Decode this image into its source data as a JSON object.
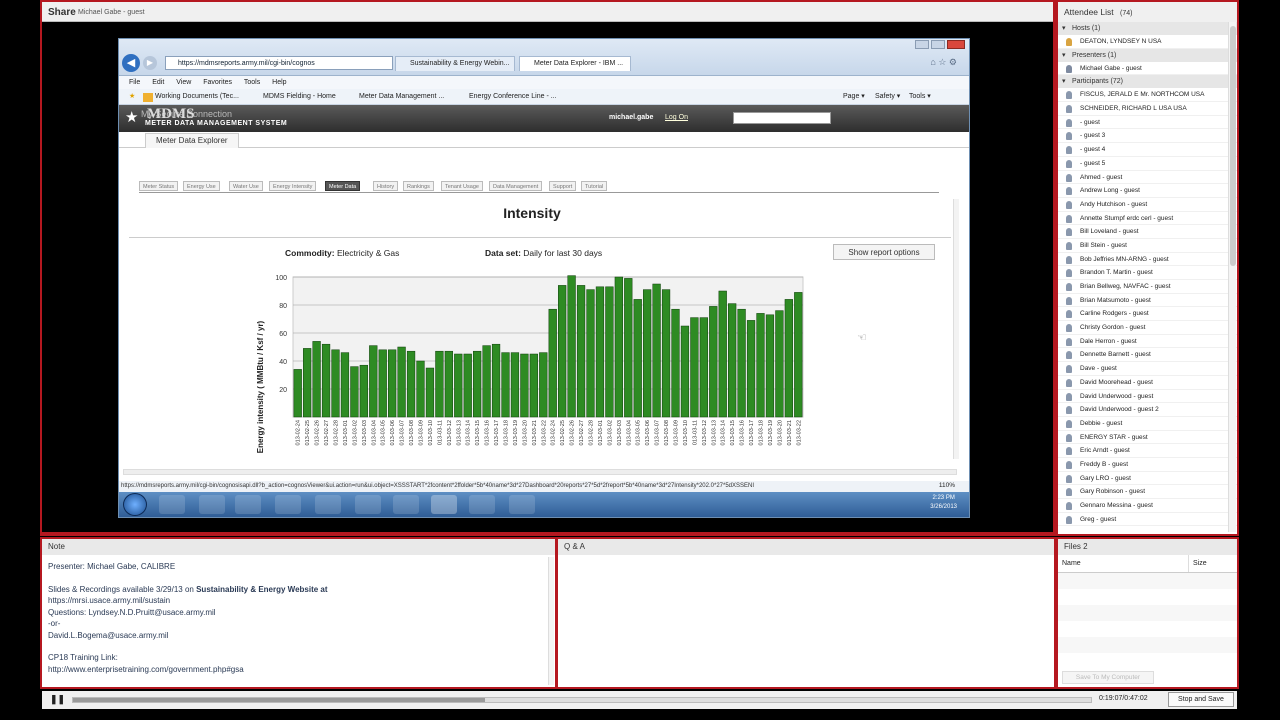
{
  "share": {
    "title": "Share",
    "presenter": "Michael Gabe - guest"
  },
  "browser": {
    "url": "https://mdmsreports.army.mil/cgi-bin/cognos",
    "tabs": [
      "Sustainability & Energy Webin...",
      "Meter Data Explorer - IBM ..."
    ],
    "menu": [
      "File",
      "Edit",
      "View",
      "Favorites",
      "Tools",
      "Help"
    ],
    "favorites": [
      "Working Documents (Tec...",
      "MDMS Fielding - Home",
      "Meter Data Management ...",
      "Energy Conference Line - ..."
    ],
    "cmdbar": [
      "Page ▾",
      "Safety ▾",
      "Tools ▾"
    ],
    "status_url": "https://mdmsreports.army.mil/cgi-bin/cognosisapi.dll?b_action=cognosViewer&ui.action=run&ui.object=XSSSTART*2fcontent*2ffolder*5b*40name*3d*27Dashboard*20reports*27*5d*2freport*5b*40name*3d*27Intensity*202.0*27*5dXSSENI",
    "zoom": "110%",
    "clock_time": "2:23 PM",
    "clock_date": "3/26/2013"
  },
  "mdms": {
    "logo": "MDMS",
    "subtitle": "METER DATA MANAGEMENT SYSTEM",
    "overlay": "My Secure Connection",
    "user": "michael.gabe",
    "logon": "Log On",
    "app_tab": "Meter Data Explorer",
    "subtabs": [
      "Meter Status",
      "Energy Use",
      "Water Use",
      "Energy Intensity",
      "Meter Data",
      "History",
      "Rankings",
      "Tenant Usage",
      "Data Management",
      "Support",
      "Tutorial"
    ],
    "active_subtab": "Meter Data",
    "report_title": "Intensity",
    "commodity_label": "Commodity:",
    "commodity_value": "Electricity & Gas",
    "dataset_label": "Data set:",
    "dataset_value": "Daily for last 30 days",
    "options_button": "Show report options"
  },
  "chart_data": {
    "type": "bar",
    "ylabel": "Energy intensity ( MMBtu / Ksf / yr)",
    "ylim": [
      0,
      100
    ],
    "yticks": [
      "100",
      "80",
      "60",
      "40",
      "20"
    ],
    "color": "#2e8b23",
    "categories": [
      "013-02-24",
      "013-02-25",
      "013-02-26",
      "013-02-27",
      "013-02-28",
      "013-03-01",
      "013-03-02",
      "013-03-03",
      "013-03-04",
      "013-03-05",
      "013-03-06",
      "013-03-07",
      "013-03-08",
      "013-03-09",
      "013-03-10",
      "013-03-11",
      "013-03-12",
      "013-03-13",
      "013-03-14",
      "013-03-15",
      "013-03-16",
      "013-03-17",
      "013-03-18",
      "013-03-19",
      "013-03-20",
      "013-03-21",
      "013-03-22",
      "013-02-24",
      "013-02-25",
      "013-02-26",
      "013-02-27",
      "013-02-28",
      "013-03-01",
      "013-03-02",
      "013-03-03",
      "013-03-04",
      "013-03-05",
      "013-03-06",
      "013-03-07",
      "013-03-08",
      "013-03-09",
      "013-03-10",
      "013-03-11",
      "013-03-12",
      "013-03-13",
      "013-03-14",
      "013-03-15",
      "013-03-16",
      "013-03-17",
      "013-03-18",
      "013-03-19",
      "013-03-20",
      "013-03-21",
      "013-03-22"
    ],
    "values": [
      34,
      49,
      54,
      52,
      48,
      46,
      36,
      37,
      51,
      48,
      48,
      50,
      47,
      40,
      35,
      47,
      47,
      45,
      45,
      47,
      51,
      52,
      46,
      46,
      45,
      45,
      46,
      77,
      94,
      101,
      94,
      91,
      93,
      93,
      100,
      99,
      84,
      91,
      95,
      91,
      77,
      65,
      71,
      71,
      79,
      90,
      81,
      77,
      69,
      74,
      73,
      76,
      84,
      89
    ]
  },
  "attendees": {
    "title": "Attendee List",
    "count": "(74)",
    "hosts_label": "Hosts (1)",
    "hosts": [
      "DEATON, LYNDSEY N USA"
    ],
    "presenters_label": "Presenters (1)",
    "presenters": [
      "Michael Gabe - guest"
    ],
    "participants_label": "Participants (72)",
    "participants": [
      "FISCUS, JERALD E Mr. NORTHCOM USA",
      "SCHNEIDER, RICHARD L USA USA",
      "- guest",
      "- guest 3",
      "- guest 4",
      "- guest 5",
      "Ahmed - guest",
      "Andrew Long - guest",
      "Andy Hutchison - guest",
      "Annette Stumpf erdc cerl - guest",
      "Bill Loveland - guest",
      "Bill Stein - guest",
      "Bob Jeffries MN-ARNG - guest",
      "Brandon T. Martin - guest",
      "Brian Bellweg, NAVFAC - guest",
      "Brian Matsumoto - guest",
      "Carline Rodgers - guest",
      "Christy Gordon - guest",
      "Dale Herron - guest",
      "Dennette Barnett - guest",
      "Dave - guest",
      "David Moorehead - guest",
      "David Underwood - guest",
      "David Underwood - guest 2",
      "Debbie - guest",
      "ENERGY STAR - guest",
      "Eric Arndt - guest",
      "Freddy B - guest",
      "Gary LRO - guest",
      "Gary Robinson - guest",
      "Gennaro Messina - guest",
      "Greg - guest"
    ]
  },
  "note": {
    "title": "Note",
    "presenter": "Presenter: Michael Gabe, CALIBRE",
    "slides_prefix": "Slides & Recordings available 3/29/13 on ",
    "slides_site": "Sustainability & Energy Website at",
    "slides_url": "https://mrsi.usace.army.mil/sustain",
    "questions": "Questions: Lyndsey.N.D.Pruitt@usace.army.mil",
    "or": "-or-",
    "email2": "David.L.Bogema@usace.army.mil",
    "training_label": "CP18 Training Link:",
    "training_url": "http://www.enterprisetraining.com/government.php#gsa"
  },
  "qa": {
    "title": "Q & A"
  },
  "files": {
    "title": "Files 2",
    "col_name": "Name",
    "col_size": "Size",
    "save_button": "Save To My Computer"
  },
  "player": {
    "time": "0:19:07/0:47:02",
    "stop_save": "Stop and Save",
    "progress": 0.405
  }
}
